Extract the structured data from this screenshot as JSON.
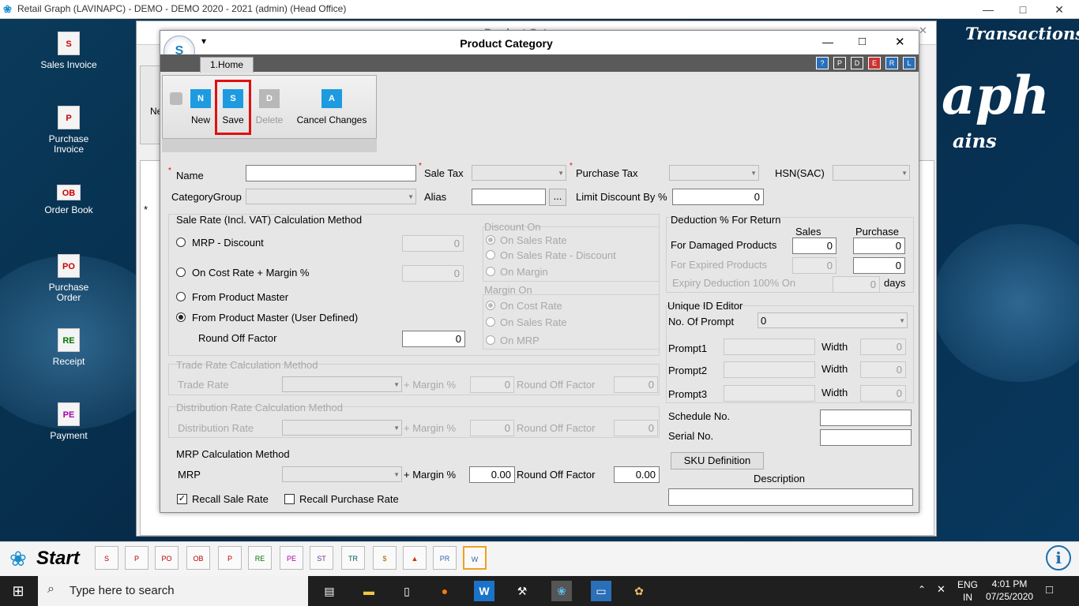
{
  "app_title": "Retail Graph (LAVINAPC) - DEMO - DEMO  2020 - 2021 (admin) (Head Office)",
  "window_controls": {
    "minimize": "—",
    "maximize": "□",
    "close": "✕"
  },
  "desktop": {
    "brand_lines": [
      "Transactions",
      "aph",
      "ains"
    ],
    "icons": [
      {
        "label": "Sales Invoice",
        "glyph": "S"
      },
      {
        "label": "Purchase Invoice",
        "glyph": "P"
      },
      {
        "label": "Order Book",
        "glyph": "OB"
      },
      {
        "label": "Purchase Order",
        "glyph": "PO"
      },
      {
        "label": "Receipt",
        "glyph": "RE"
      },
      {
        "label": "Payment",
        "glyph": "PE"
      }
    ]
  },
  "background_window": {
    "title": "Product Cat...",
    "partial_label": "Ne",
    "row_marker": "*"
  },
  "dialog": {
    "title": "Product Category",
    "logo_letter": "S",
    "qat_arrow": "▾",
    "tab": "1.Home",
    "ribbon": {
      "new": "New",
      "save": "Save",
      "delete": "Delete",
      "cancel": "Cancel Changes"
    },
    "fields": {
      "name_label": "Name",
      "name_value": "",
      "sale_tax_label": "Sale Tax",
      "purchase_tax_label": "Purchase Tax",
      "hsn_label": "HSN(SAC)",
      "category_group_label": "CategoryGroup",
      "alias_label": "Alias",
      "alias_button": "...",
      "limit_discount_label": "Limit Discount By %",
      "limit_discount_value": "0",
      "required_mark": "*"
    },
    "sale_rate": {
      "title": "Sale Rate (Incl. VAT) Calculation Method",
      "options": [
        "MRP - Discount",
        "On Cost Rate + Margin %",
        "From Product Master",
        "From Product Master (User Defined)"
      ],
      "selected": "From Product Master (User Defined)",
      "mrp_discount_value": "0",
      "cost_margin_value": "0",
      "round_off_label": "Round Off Factor",
      "round_off_value": "0"
    },
    "discount_on": {
      "title": "Discount On",
      "options": [
        "On Sales Rate",
        "On Sales Rate - Discount",
        "On Margin"
      ],
      "selected": "On Sales Rate"
    },
    "margin_on": {
      "title": "Margin On",
      "options": [
        "On Cost Rate",
        "On Sales Rate",
        "On MRP"
      ],
      "selected": "On Cost Rate"
    },
    "trade_rate": {
      "title": "Trade Rate Calculation Method",
      "label": "Trade Rate",
      "margin_label": "+ Margin %",
      "margin_value": "0",
      "round_label": "Round Off Factor",
      "round_value": "0"
    },
    "distribution_rate": {
      "title": "Distribution Rate Calculation Method",
      "label": "Distribution Rate",
      "margin_label": "+ Margin %",
      "margin_value": "0",
      "round_label": "Round Off Factor",
      "round_value": "0"
    },
    "mrp_calc": {
      "title": "MRP Calculation Method",
      "label": "MRP",
      "margin_label": "+ Margin %",
      "margin_value": "0.00",
      "round_label": "Round Off Factor",
      "round_value": "0.00"
    },
    "recall": {
      "sale_label": "Recall Sale Rate",
      "sale_checked": true,
      "purchase_label": "Recall Purchase Rate",
      "purchase_checked": false
    },
    "deduction": {
      "title": "Deduction % For Return",
      "col_sales": "Sales",
      "col_purchase": "Purchase",
      "damaged_label": "For Damaged Products",
      "damaged_sales": "0",
      "damaged_purchase": "0",
      "expired_label": "For Expired Products",
      "expired_sales": "0",
      "expired_purchase": "0",
      "expiry_label": "Expiry Deduction 100% On",
      "expiry_value": "0",
      "days_label": "days"
    },
    "unique_id": {
      "title": "Unique ID Editor",
      "prompt_count_label": "No. Of Prompt",
      "prompt_count_value": "0",
      "prompts": [
        {
          "label": "Prompt1",
          "width_label": "Width",
          "width": "0"
        },
        {
          "label": "Prompt2",
          "width_label": "Width",
          "width": "0"
        },
        {
          "label": "Prompt3",
          "width_label": "Width",
          "width": "0"
        }
      ]
    },
    "schedule_label": "Schedule No.",
    "serial_label": "Serial No.",
    "sku_button": "SKU Definition",
    "description_label": "Description"
  },
  "taskbar_app": {
    "start_label": "Start"
  },
  "taskbar": {
    "search_placeholder": "Type here to search",
    "lang_top": "ENG",
    "lang_bottom": "IN",
    "time": "4:01 PM",
    "date": "07/25/2020"
  }
}
